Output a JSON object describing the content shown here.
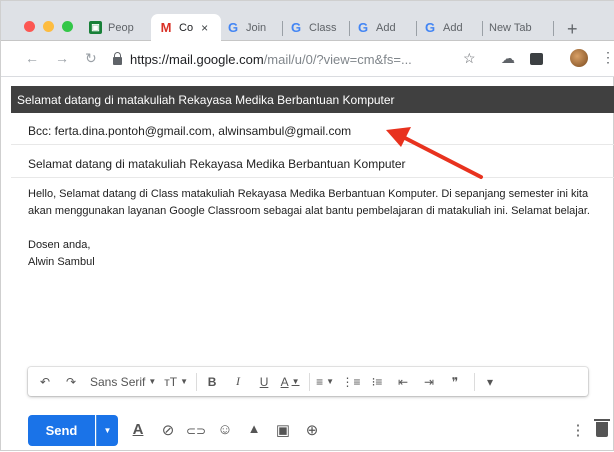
{
  "browser": {
    "tabs": [
      {
        "label": "Peop",
        "favicon": "contacts-icon",
        "active": false
      },
      {
        "label": "Co",
        "favicon": "gmail-icon",
        "active": true
      },
      {
        "label": "Join",
        "favicon": "google-icon",
        "active": false
      },
      {
        "label": "Class",
        "favicon": "google-icon",
        "active": false
      },
      {
        "label": "Add",
        "favicon": "google-icon",
        "active": false
      },
      {
        "label": "Add",
        "favicon": "google-icon",
        "active": false
      },
      {
        "label": "New Tab",
        "favicon": "",
        "active": false
      }
    ],
    "close_glyph": "×",
    "new_tab_glyph": "+",
    "url_host": "https://mail.google.com",
    "url_path": "/mail/u/0/?view=cm&fs=...",
    "favicon_letters": {
      "sheet": "▣",
      "gmail": "M",
      "google": "G"
    }
  },
  "compose": {
    "title": "Selamat datang di matakuliah Rekayasa Medika Berbantuan Komputer",
    "bcc": "Bcc: ferta.dina.pontoh@gmail.com, alwinsambul@gmail.com",
    "subject": "Selamat datang di matakuliah Rekayasa Medika Berbantuan Komputer",
    "body_paragraph": "Hello, Selamat datang di Class matakuliah Rekayasa Medika Berbantuan Komputer. Di sepanjang semester ini kita akan menggunakan layanan Google Classroom sebagai alat bantu pembelajaran di matakuliah ini. Selamat belajar.",
    "signature_line1": "Dosen anda,",
    "signature_line2": "Alwin Sambul"
  },
  "toolbar": {
    "undo": "↶",
    "redo": "↷",
    "font": "Sans Serif",
    "size": "тT",
    "bold": "B",
    "italic": "I",
    "underline": "U",
    "text_color": "A",
    "align": "≡",
    "numbered": "⋮≡",
    "bulleted": "⁝≡",
    "indent_less": "⇤",
    "indent_more": "⇥",
    "quote": "❞",
    "more": "▾"
  },
  "actions": {
    "send": "Send",
    "format_toggle": "A",
    "attach": "⊘",
    "link": "⊂⊃",
    "emoji": "☺",
    "drive": "▲",
    "photo": "▣",
    "confidential": "⊕",
    "more_options": "⋮"
  },
  "colors": {
    "send_blue": "#1a73e8",
    "title_bar": "#404040",
    "arrow_red": "#e8321e"
  }
}
